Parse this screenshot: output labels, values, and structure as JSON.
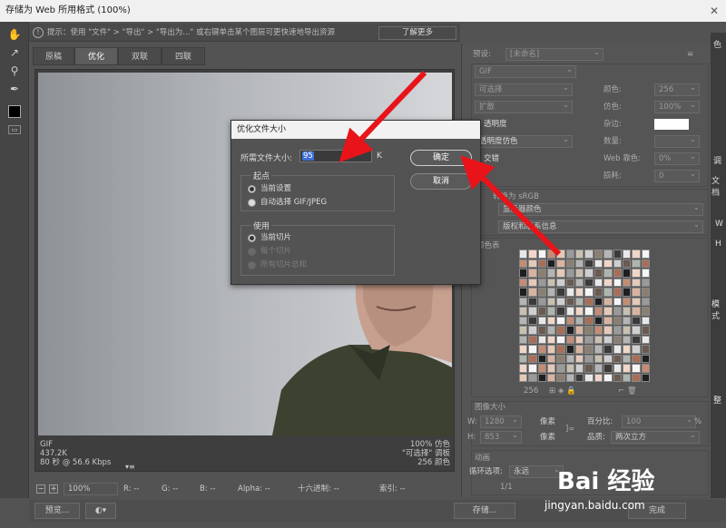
{
  "window": {
    "title": "存储为 Web 所用格式 (100%)",
    "close": "✕"
  },
  "hint": {
    "text": "提示：使用 \"文件\" > \"导出\" > \"导出为...\" 或右键单击某个图层可更快速地导出资源",
    "learn_more": "了解更多"
  },
  "tabs": [
    {
      "label": "原稿"
    },
    {
      "label": "优化"
    },
    {
      "label": "双联"
    },
    {
      "label": "四联"
    }
  ],
  "image_info": {
    "format": "GIF",
    "size": "437.2K",
    "time": "80 秒 @ 56.6 Kbps",
    "quality": "100% 仿色",
    "palette_mode": "\"可选择\" 调板",
    "colors": "256 颜色"
  },
  "status_bar": {
    "zoom": "100%",
    "r": "R: --",
    "g": "G: --",
    "b": "B: --",
    "alpha": "Alpha: --",
    "hex": "十六进制: --",
    "index": "索引: --"
  },
  "bottom": {
    "preview": "预览...",
    "save": "存储...",
    "done": "完成"
  },
  "right_panel": {
    "preset_label": "预设:",
    "preset_value": "[未命名]",
    "format": "GIF",
    "reduction": "可选择",
    "colors_label": "颜色:",
    "colors_value": "256",
    "dither_algo": "扩散",
    "dither_label": "仿色:",
    "dither_value": "100%",
    "transparency": "透明度",
    "matte_label": "杂边:",
    "trans_dither": "透明度仿色",
    "amount_label": "数量:",
    "interlaced": "交错",
    "web_snap_label": "Web 靠色:",
    "web_snap_value": "0%",
    "lossy_label": "损耗:",
    "lossy_value": "0",
    "convert_srgb": "转换为 sRGB",
    "preview_label": "显示器颜色",
    "metadata_label": "版权和联系信息",
    "color_table": "颜色表",
    "palette_count": "256",
    "image_size": "图像大小",
    "w_label": "W:",
    "w_value": "1280",
    "h_label": "H:",
    "h_value": "853",
    "px1": "像素",
    "px2": "像素",
    "percent_label": "百分比:",
    "percent_value": "100",
    "pct": "%",
    "quality_label": "品质:",
    "quality_value": "两次立方",
    "animation": "动画",
    "loop_label": "循环选项:",
    "loop_value": "永远",
    "frame": "1/1"
  },
  "dialog": {
    "title": "优化文件大小",
    "size_label": "所需文件大小:",
    "size_value": "95",
    "unit": "K",
    "start_group": "起点",
    "opt_current": "当前设置",
    "opt_auto": "自动选择 GIF/JPEG",
    "use_group": "使用",
    "use_current_slice": "当前切片",
    "use_each_slice": "每个切片",
    "use_all_slices": "所有切片总和",
    "ok": "确定",
    "cancel": "取消"
  },
  "watermark": {
    "brand": "Bai 经验",
    "url": "jingyan.baidu.com"
  },
  "far_right": {
    "labels": [
      "色",
      "调",
      "文档",
      "W",
      "H",
      "模式",
      "整"
    ]
  },
  "colors": {
    "arrow": "#e8141a",
    "accent": "#3d6fd6"
  }
}
